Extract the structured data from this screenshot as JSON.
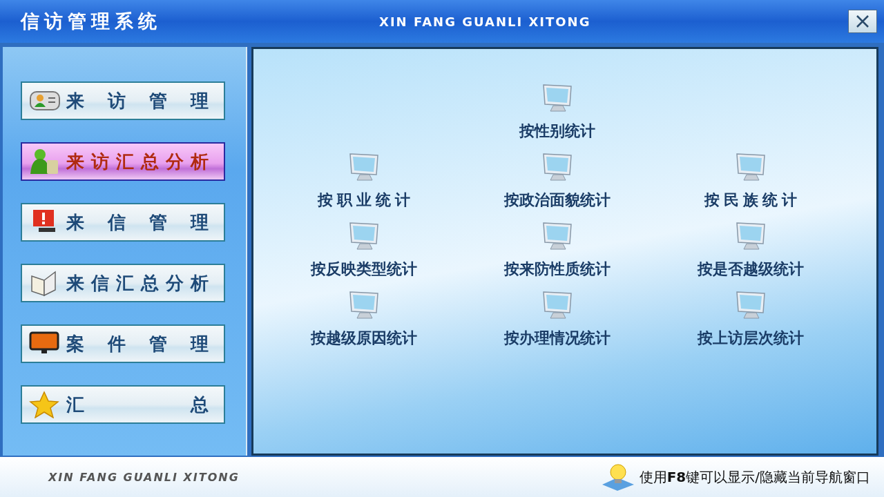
{
  "window": {
    "title": "信访管理系统",
    "subtitle": "XIN FANG GUANLI XITONG"
  },
  "sidebar": {
    "items": [
      {
        "label": "来 访 管 理",
        "selected": false
      },
      {
        "label": "来访汇总分析",
        "selected": true
      },
      {
        "label": "来 信 管 理",
        "selected": false
      },
      {
        "label": "来信汇总分析",
        "selected": false
      },
      {
        "label": "案 件 管 理",
        "selected": false
      },
      {
        "label": "汇 总",
        "selected": false
      }
    ]
  },
  "main": {
    "rows": [
      {
        "items": [
          "按性别统计"
        ]
      },
      {
        "items": [
          "按 职 业 统 计",
          "按政治面貌统计",
          "按 民 族 统 计"
        ]
      },
      {
        "items": [
          "按反映类型统计",
          "按来防性质统计",
          "按是否越级统计"
        ]
      },
      {
        "items": [
          "按越级原因统计",
          "按办理情况统计",
          "按上访层次统计"
        ]
      }
    ]
  },
  "status_bar": {
    "brand": "XIN FANG GUANLI XITONG",
    "hint": "使用**F8**键可以显示/隐藏当前导航窗口"
  }
}
